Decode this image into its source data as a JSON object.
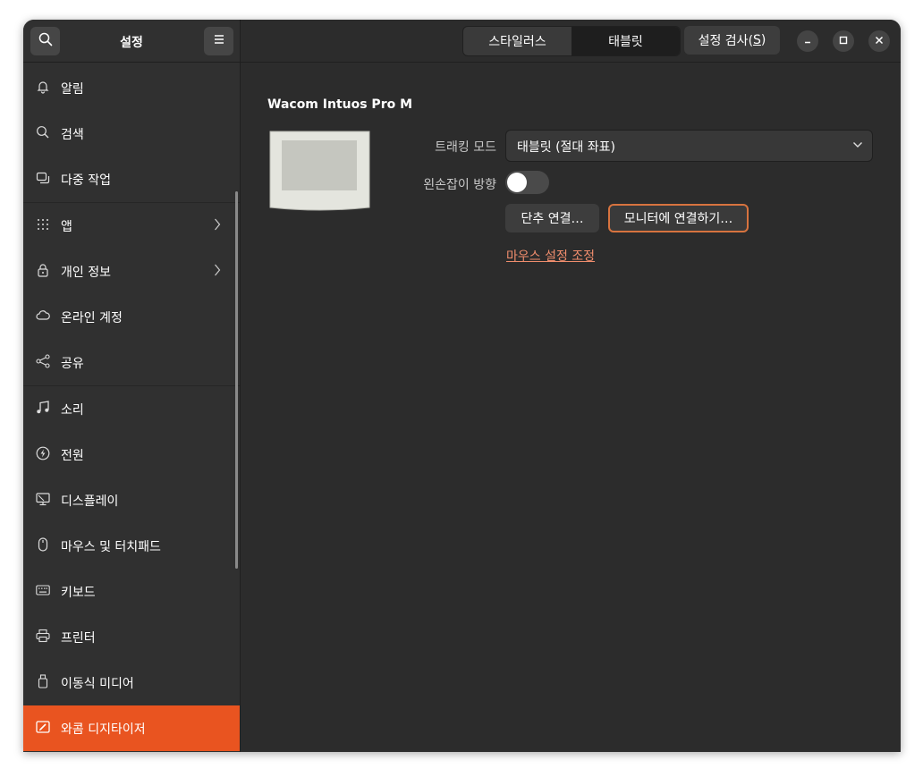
{
  "sidebar": {
    "title": "설정",
    "search_icon": "search-icon",
    "menu_icon": "hamburger-menu-icon",
    "items": [
      {
        "label": "알림",
        "icon": "bell-icon"
      },
      {
        "label": "검색",
        "icon": "search-icon"
      },
      {
        "label": "다중 작업",
        "icon": "multitasking-icon"
      },
      {
        "label": "앱",
        "icon": "apps-grid-icon"
      },
      {
        "label": "개인 정보",
        "icon": "lock-icon"
      },
      {
        "label": "온라인 계정",
        "icon": "cloud-icon"
      },
      {
        "label": "공유",
        "icon": "share-icon"
      },
      {
        "label": "소리",
        "icon": "music-note-icon"
      },
      {
        "label": "전원",
        "icon": "power-icon"
      },
      {
        "label": "디스플레이",
        "icon": "display-icon"
      },
      {
        "label": "마우스 및 터치패드",
        "icon": "mouse-icon"
      },
      {
        "label": "키보드",
        "icon": "keyboard-icon"
      },
      {
        "label": "프린터",
        "icon": "printer-icon"
      },
      {
        "label": "이동식 미디어",
        "icon": "usb-drive-icon"
      },
      {
        "label": "와콤 디지타이저",
        "icon": "wacom-tablet-icon"
      }
    ]
  },
  "header": {
    "tabs": [
      {
        "label": "스타일러스"
      },
      {
        "label": "태블릿"
      }
    ],
    "test_button": "설정 검사(S)",
    "test_button_main": "설정 검사(",
    "test_button_mnemonic": "S",
    "test_button_end": ")"
  },
  "device": {
    "name": "Wacom Intuos Pro M",
    "tracking_mode_label": "트래킹 모드",
    "tracking_mode_value": "태블릿 (절대 좌표)",
    "left_handed_label": "왼손잡이 방향",
    "left_handed_on": false,
    "map_buttons_label": "단추 연결…",
    "map_monitor_label": "모니터에 연결하기…",
    "mouse_settings_link": "마우스 설정 조정"
  },
  "colors": {
    "accent": "#e95420",
    "link": "#f08d6d",
    "background": "#2c2c2c"
  }
}
